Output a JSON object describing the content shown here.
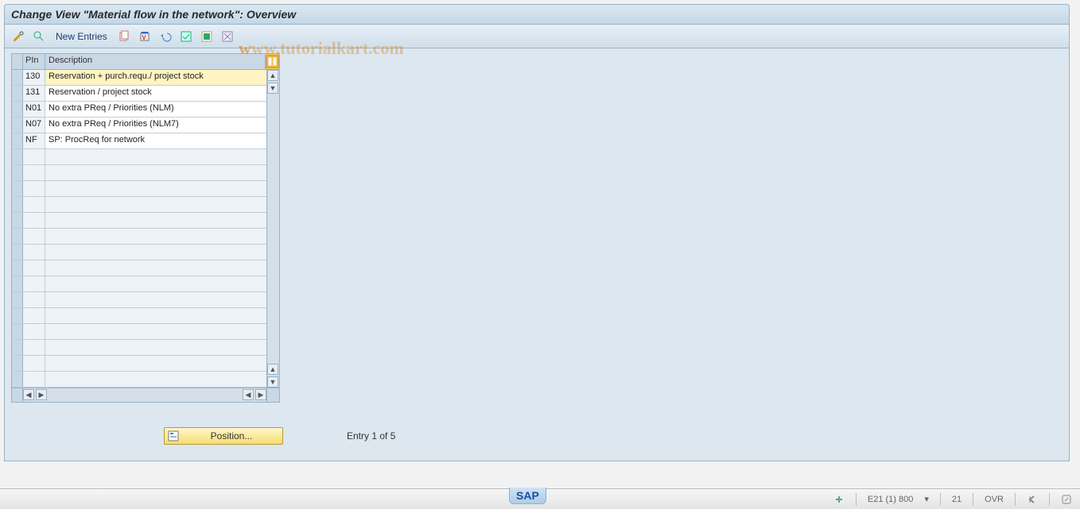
{
  "header": {
    "title": "Change View \"Material flow in the network\": Overview"
  },
  "toolbar": {
    "new_entries_label": "New Entries"
  },
  "watermark": {
    "part1": "w",
    "part2": "ww.tutorialkart.com"
  },
  "grid": {
    "columns": {
      "pin": "PIn",
      "desc": "Description"
    },
    "rows": [
      {
        "pin": "130",
        "desc": "Reservation + purch.requ./ project stock",
        "selected": true
      },
      {
        "pin": "131",
        "desc": "Reservation / project stock"
      },
      {
        "pin": "N01",
        "desc": "No  extra PReq / Priorities (NLM)"
      },
      {
        "pin": "N07",
        "desc": "No  extra PReq / Priorities (NLM7)"
      },
      {
        "pin": "NF",
        "desc": "SP: ProcReq for network"
      }
    ],
    "empty_rows_visible": 15
  },
  "footer": {
    "position_label": "Position...",
    "entry_text": "Entry 1 of 5"
  },
  "statusbar": {
    "sap_logo": "SAP",
    "system": "E21 (1) 800",
    "client_extra": "21",
    "mode": "OVR"
  }
}
